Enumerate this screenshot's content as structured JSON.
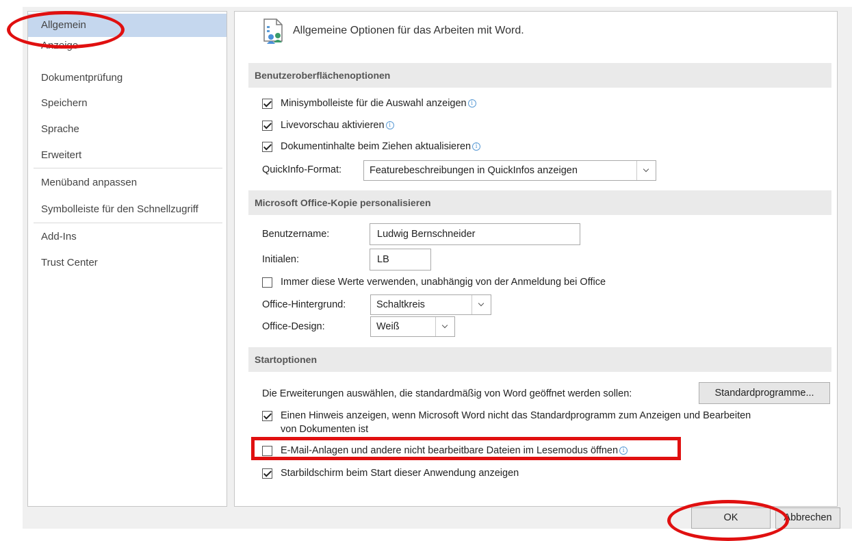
{
  "nav": {
    "items": [
      "Allgemein",
      "Anzeige",
      "Dokumentprüfung",
      "Speichern",
      "Sprache",
      "Erweitert",
      "Menüband anpassen",
      "Symbolleiste für den Schnellzugriff",
      "Add-Ins",
      "Trust Center"
    ],
    "selected": "Allgemein"
  },
  "header": {
    "text": "Allgemeine Optionen für das Arbeiten mit Word.",
    "icon": "general-options-icon"
  },
  "ui_options": {
    "title": "Benutzeroberflächenoptionen",
    "checkboxes": [
      {
        "label": "Minisymbolleiste für die Auswahl anzeigen",
        "checked": true
      },
      {
        "label": "Livevorschau aktivieren",
        "checked": true
      },
      {
        "label": "Dokumentinhalte beim Ziehen aktualisieren",
        "checked": true
      }
    ],
    "quickinfo_label": "QuickInfo-Format:",
    "quickinfo_value": "Featurebeschreibungen in QuickInfos anzeigen"
  },
  "personalize": {
    "title": "Microsoft Office-Kopie personalisieren",
    "username_label": "Benutzername:",
    "username_value": "Ludwig Bernschneider",
    "initials_label": "Initialen:",
    "initials_value": "LB",
    "always_use": {
      "label": "Immer diese Werte verwenden, unabhängig von der Anmeldung bei Office",
      "checked": false
    },
    "background_label": "Office-Hintergrund:",
    "background_value": "Schaltkreis",
    "design_label": "Office-Design:",
    "design_value": "Weiß"
  },
  "startup": {
    "title": "Startoptionen",
    "extensions_text": "Die Erweiterungen auswählen, die standardmäßig von Word geöffnet werden sollen:",
    "default_programs_button": "Standardprogramme...",
    "hint": {
      "label_line1": "Einen Hinweis anzeigen, wenn Microsoft Word nicht das Standardprogramm zum Anzeigen und Bearbeiten",
      "label_line2": "von Dokumenten ist",
      "checked": true
    },
    "reading_mode": {
      "label": "E-Mail-Anlagen und andere nicht bearbeitbare Dateien im Lesemodus öffnen",
      "checked": false
    },
    "start_screen": {
      "label": "Starbildschirm beim Start dieser Anwendung anzeigen",
      "checked": true
    }
  },
  "footer": {
    "ok": "OK",
    "cancel": "Abbrechen"
  },
  "colors": {
    "annotation": "#e01010",
    "nav_selected": "#c5d7ee",
    "section_bar": "#eaeaea"
  }
}
